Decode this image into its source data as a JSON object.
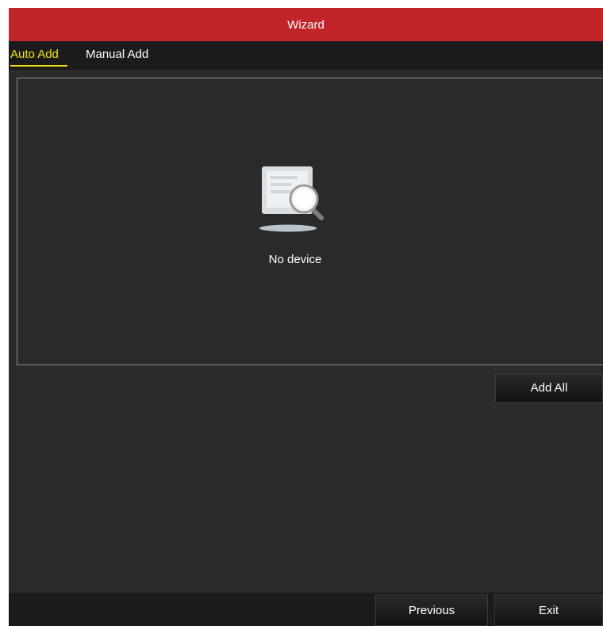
{
  "window": {
    "title": "Wizard"
  },
  "tabs": [
    {
      "label": "Auto Add",
      "active": true
    },
    {
      "label": "Manual Add",
      "active": false
    }
  ],
  "device_list": {
    "empty_icon": "device-search-icon",
    "empty_text": "No device"
  },
  "actions": {
    "add_all_label": "Add All"
  },
  "footer": {
    "previous_label": "Previous",
    "exit_label": "Exit"
  },
  "colors": {
    "title_bar": "#c1252a",
    "active_tab": "#f3e21c",
    "background": "#2b2b2b",
    "bar_background": "#1b1b1b"
  }
}
